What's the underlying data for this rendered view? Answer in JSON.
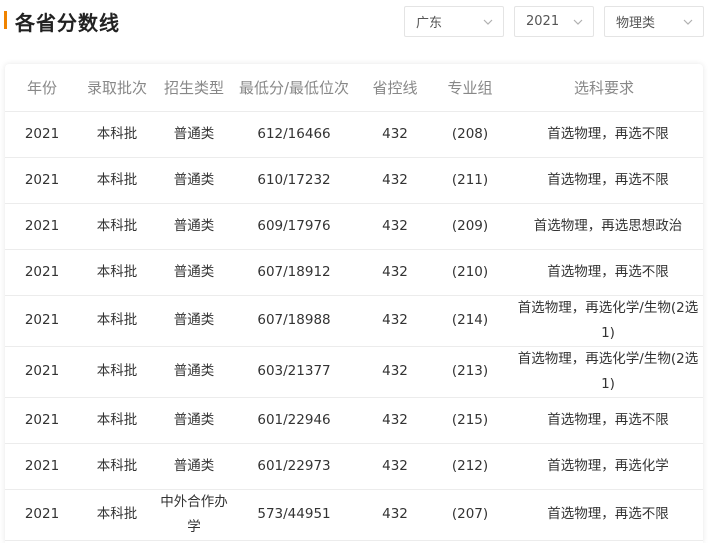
{
  "header": {
    "title": "各省分数线",
    "filters": {
      "province": "广东",
      "year": "2021",
      "subject_type": "物理类"
    },
    "accent_color": "#f08300"
  },
  "table": {
    "columns": [
      "年份",
      "录取批次",
      "招生类型",
      "最低分/最低位次",
      "省控线",
      "专业组",
      "选科要求"
    ],
    "rows": [
      {
        "year": "2021",
        "batch": "本科批",
        "type": "普通类",
        "min_score_rank": "612/16466",
        "control_line": "432",
        "group": "(208)",
        "requirement": "首选物理，再选不限"
      },
      {
        "year": "2021",
        "batch": "本科批",
        "type": "普通类",
        "min_score_rank": "610/17232",
        "control_line": "432",
        "group": "(211)",
        "requirement": "首选物理，再选不限"
      },
      {
        "year": "2021",
        "batch": "本科批",
        "type": "普通类",
        "min_score_rank": "609/17976",
        "control_line": "432",
        "group": "(209)",
        "requirement": "首选物理，再选思想政治"
      },
      {
        "year": "2021",
        "batch": "本科批",
        "type": "普通类",
        "min_score_rank": "607/18912",
        "control_line": "432",
        "group": "(210)",
        "requirement": "首选物理，再选不限"
      },
      {
        "year": "2021",
        "batch": "本科批",
        "type": "普通类",
        "min_score_rank": "607/18988",
        "control_line": "432",
        "group": "(214)",
        "requirement": "首选物理，再选化学/生物(2选1)"
      },
      {
        "year": "2021",
        "batch": "本科批",
        "type": "普通类",
        "min_score_rank": "603/21377",
        "control_line": "432",
        "group": "(213)",
        "requirement": "首选物理，再选化学/生物(2选1)"
      },
      {
        "year": "2021",
        "batch": "本科批",
        "type": "普通类",
        "min_score_rank": "601/22946",
        "control_line": "432",
        "group": "(215)",
        "requirement": "首选物理，再选不限"
      },
      {
        "year": "2021",
        "batch": "本科批",
        "type": "普通类",
        "min_score_rank": "601/22973",
        "control_line": "432",
        "group": "(212)",
        "requirement": "首选物理，再选化学"
      },
      {
        "year": "2021",
        "batch": "本科批",
        "type": "中外合作办学",
        "min_score_rank": "573/44951",
        "control_line": "432",
        "group": "(207)",
        "requirement": "首选物理，再选不限"
      }
    ]
  }
}
